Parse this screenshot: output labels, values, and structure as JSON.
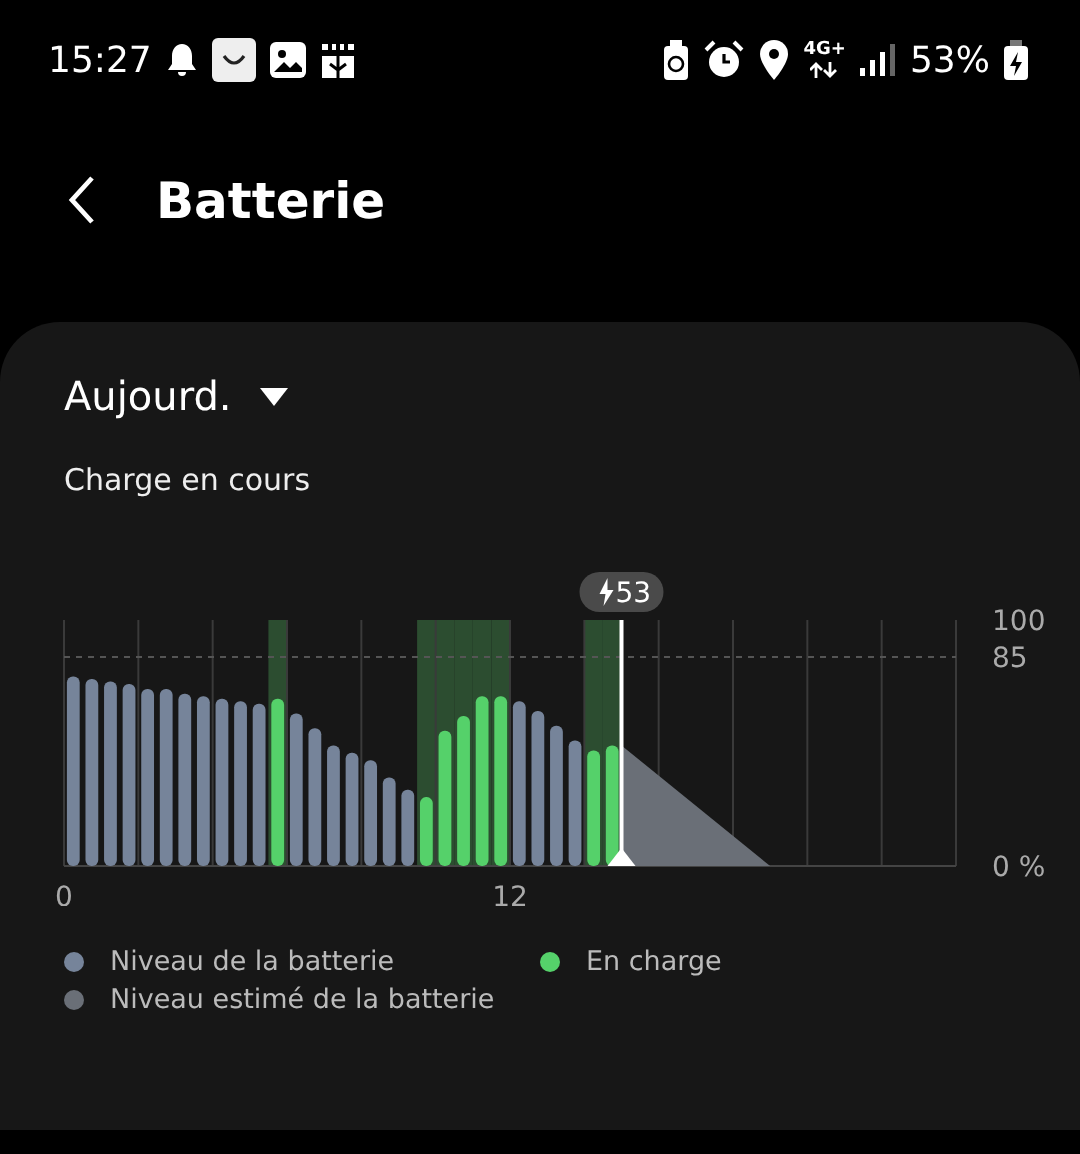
{
  "status_bar": {
    "time": "15:27",
    "network": "4G+",
    "battery": "53%"
  },
  "header": {
    "title": "Batterie"
  },
  "period": {
    "label": "Aujourd."
  },
  "state": "Charge en cours",
  "chart_data": {
    "type": "bar",
    "ref_lines": [
      {
        "axis": "y",
        "value": 85
      },
      {
        "axis": "x",
        "value": 15
      }
    ],
    "x": [
      0,
      0.5,
      1,
      1.5,
      2,
      2.5,
      3,
      3.5,
      4,
      4.5,
      5,
      5.5,
      6,
      6.5,
      7,
      7.5,
      8,
      8.5,
      9,
      9.5,
      10,
      10.5,
      11,
      11.5,
      12,
      12.5,
      13,
      13.5,
      14,
      14.5
    ],
    "series": [
      {
        "name": "Niveau de la batterie",
        "color": "#76849a",
        "values": [
          77,
          76,
          75,
          74,
          72,
          72,
          70,
          69,
          68,
          67,
          66,
          null,
          62,
          56,
          49,
          46,
          43,
          36,
          31,
          null,
          null,
          null,
          null,
          null,
          67,
          63,
          57,
          51,
          null,
          null
        ]
      },
      {
        "name": "En charge",
        "color": "#55d16a",
        "values": [
          null,
          null,
          null,
          null,
          null,
          null,
          null,
          null,
          null,
          null,
          null,
          68,
          null,
          null,
          null,
          null,
          null,
          null,
          null,
          28,
          55,
          61,
          69,
          69,
          null,
          null,
          null,
          null,
          47,
          49
        ]
      }
    ],
    "xlim": [
      0,
      24
    ],
    "ylim": [
      0,
      100
    ],
    "xticks": [
      0,
      12
    ],
    "yticks": [
      {
        "value": 0,
        "label": "0 %"
      },
      85,
      100
    ],
    "annotations": [
      "53"
    ]
  },
  "estimate_legend": {
    "label": "Niveau estimé de la batterie",
    "color": "#6a6f77"
  }
}
